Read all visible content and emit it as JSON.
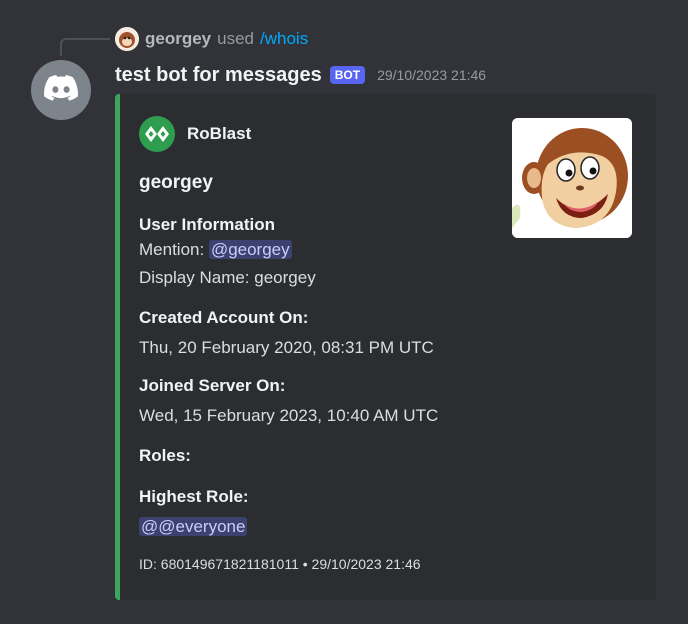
{
  "reply": {
    "username": "georgey",
    "used_text": "used",
    "command": "/whois"
  },
  "message": {
    "username": "test bot for messages",
    "bot_tag": "BOT",
    "timestamp": "29/10/2023 21:46"
  },
  "embed": {
    "accent_color": "#3ba55c",
    "author_name": "RoBlast",
    "title": "georgey",
    "user_info": {
      "name": "User Information",
      "mention_label": "Mention:",
      "mention_value": "@georgey",
      "display_name": "Display Name: georgey"
    },
    "created": {
      "name": "Created Account On:",
      "value": "Thu, 20 February 2020, 08:31 PM UTC"
    },
    "joined": {
      "name": "Joined Server On:",
      "value": "Wed, 15 February 2023, 10:40 AM UTC"
    },
    "roles": {
      "name": "Roles:"
    },
    "highest_role": {
      "name": "Highest Role:",
      "value": "@@everyone"
    },
    "footer": "ID: 680149671821181011 • 29/10/2023 21:46"
  },
  "icons": {
    "bot_avatar": "discord-logo-icon",
    "author_icon": "roblast-logo-icon",
    "thumbnail": "curious-monkey-avatar"
  }
}
